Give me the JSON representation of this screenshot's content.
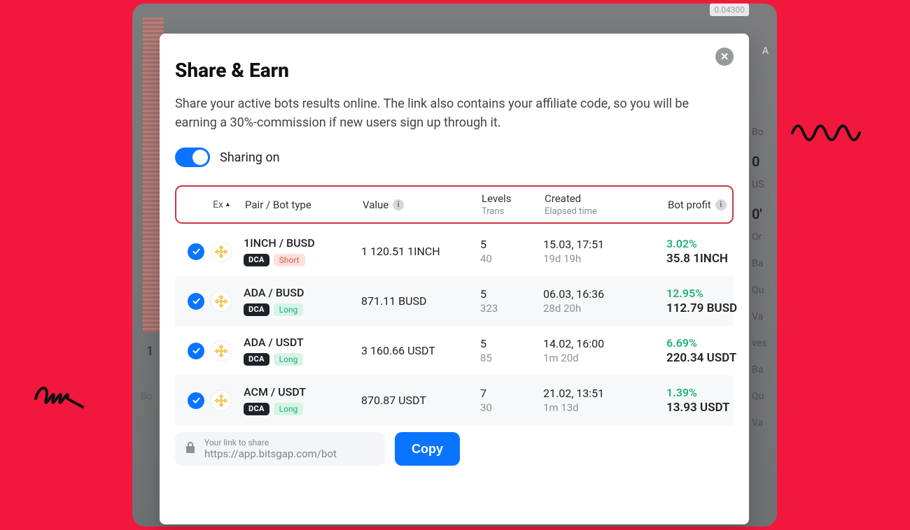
{
  "background": {
    "price_top_right": "0.04300",
    "right_letter": "A",
    "right_col": [
      "Bo",
      "0",
      "US",
      "0'",
      "Or",
      "Ba",
      "Qu",
      "Va",
      "ves",
      "Ba",
      "Qu",
      "Va"
    ],
    "left_num": "1",
    "left_label": "Bo"
  },
  "modal": {
    "title": "Share & Earn",
    "description": "Share your active bots results online. The link also contains your affiliate code, so you will be earning a 30%-commission if new users sign up through it.",
    "toggle_label": "Sharing on",
    "headers": {
      "ex": "Ex",
      "pair": "Pair / Bot type",
      "value": "Value",
      "levels": "Levels",
      "levels_sub": "Trans",
      "created": "Created",
      "created_sub": "Elapsed time",
      "profit": "Bot profit"
    },
    "rows": [
      {
        "pair": "1INCH / BUSD",
        "bot_type": "DCA",
        "side": "Short",
        "value": "1 120.51 1INCH",
        "levels": "5",
        "trans": "40",
        "created": "15.03, 17:51",
        "elapsed": "19d 19h",
        "profit_pct": "3.02%",
        "profit_amt": "35.8 1INCH"
      },
      {
        "pair": "ADA / BUSD",
        "bot_type": "DCA",
        "side": "Long",
        "value": "871.11 BUSD",
        "levels": "5",
        "trans": "323",
        "created": "06.03, 16:36",
        "elapsed": "28d 20h",
        "profit_pct": "12.95%",
        "profit_amt": "112.79 BUSD"
      },
      {
        "pair": "ADA / USDT",
        "bot_type": "DCA",
        "side": "Long",
        "value": "3 160.66 USDT",
        "levels": "5",
        "trans": "85",
        "created": "14.02, 16:00",
        "elapsed": "1m 20d",
        "profit_pct": "6.69%",
        "profit_amt": "220.34 USDT"
      },
      {
        "pair": "ACM / USDT",
        "bot_type": "DCA",
        "side": "Long",
        "value": "870.87 USDT",
        "levels": "7",
        "trans": "30",
        "created": "21.02, 13:51",
        "elapsed": "1m 13d",
        "profit_pct": "1.39%",
        "profit_amt": "13.93 USDT"
      }
    ],
    "share_label": "Your link to share",
    "share_url": "https://app.bitsgap.com/bot",
    "copy_label": "Copy"
  }
}
